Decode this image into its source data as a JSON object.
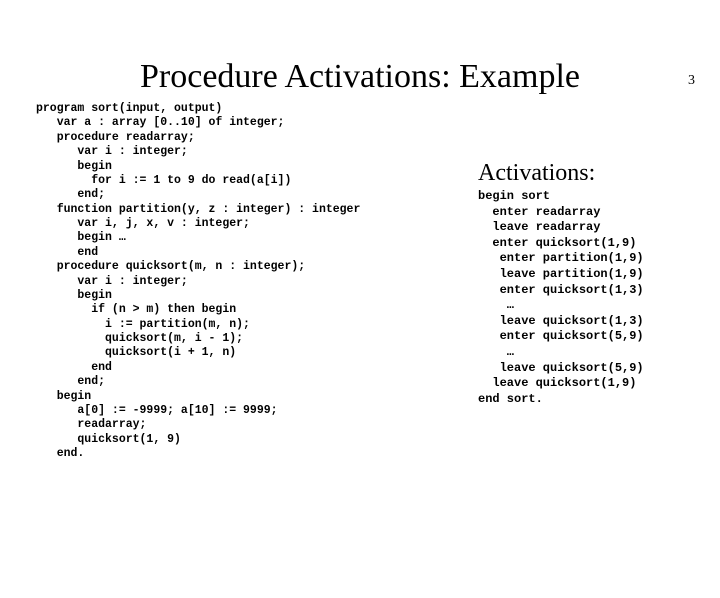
{
  "page_number": "3",
  "title": "Procedure Activations: Example",
  "code": "program sort(input, output)\n   var a : array [0..10] of integer;\n   procedure readarray;\n      var i : integer;\n      begin\n        for i := 1 to 9 do read(a[i])\n      end;\n   function partition(y, z : integer) : integer\n      var i, j, x, v : integer;\n      begin …\n      end\n   procedure quicksort(m, n : integer);\n      var i : integer;\n      begin\n        if (n > m) then begin\n          i := partition(m, n);\n          quicksort(m, i - 1);\n          quicksort(i + 1, n)\n        end\n      end;\n   begin\n      a[0] := -9999; a[10] := 9999;\n      readarray;\n      quicksort(1, 9)\n   end.",
  "activations_title": "Activations:",
  "activations": "begin sort\n  enter readarray\n  leave readarray\n  enter quicksort(1,9)\n   enter partition(1,9)\n   leave partition(1,9)\n   enter quicksort(1,3)\n    …\n   leave quicksort(1,3)\n   enter quicksort(5,9)\n    …\n   leave quicksort(5,9)\n  leave quicksort(1,9)\nend sort."
}
